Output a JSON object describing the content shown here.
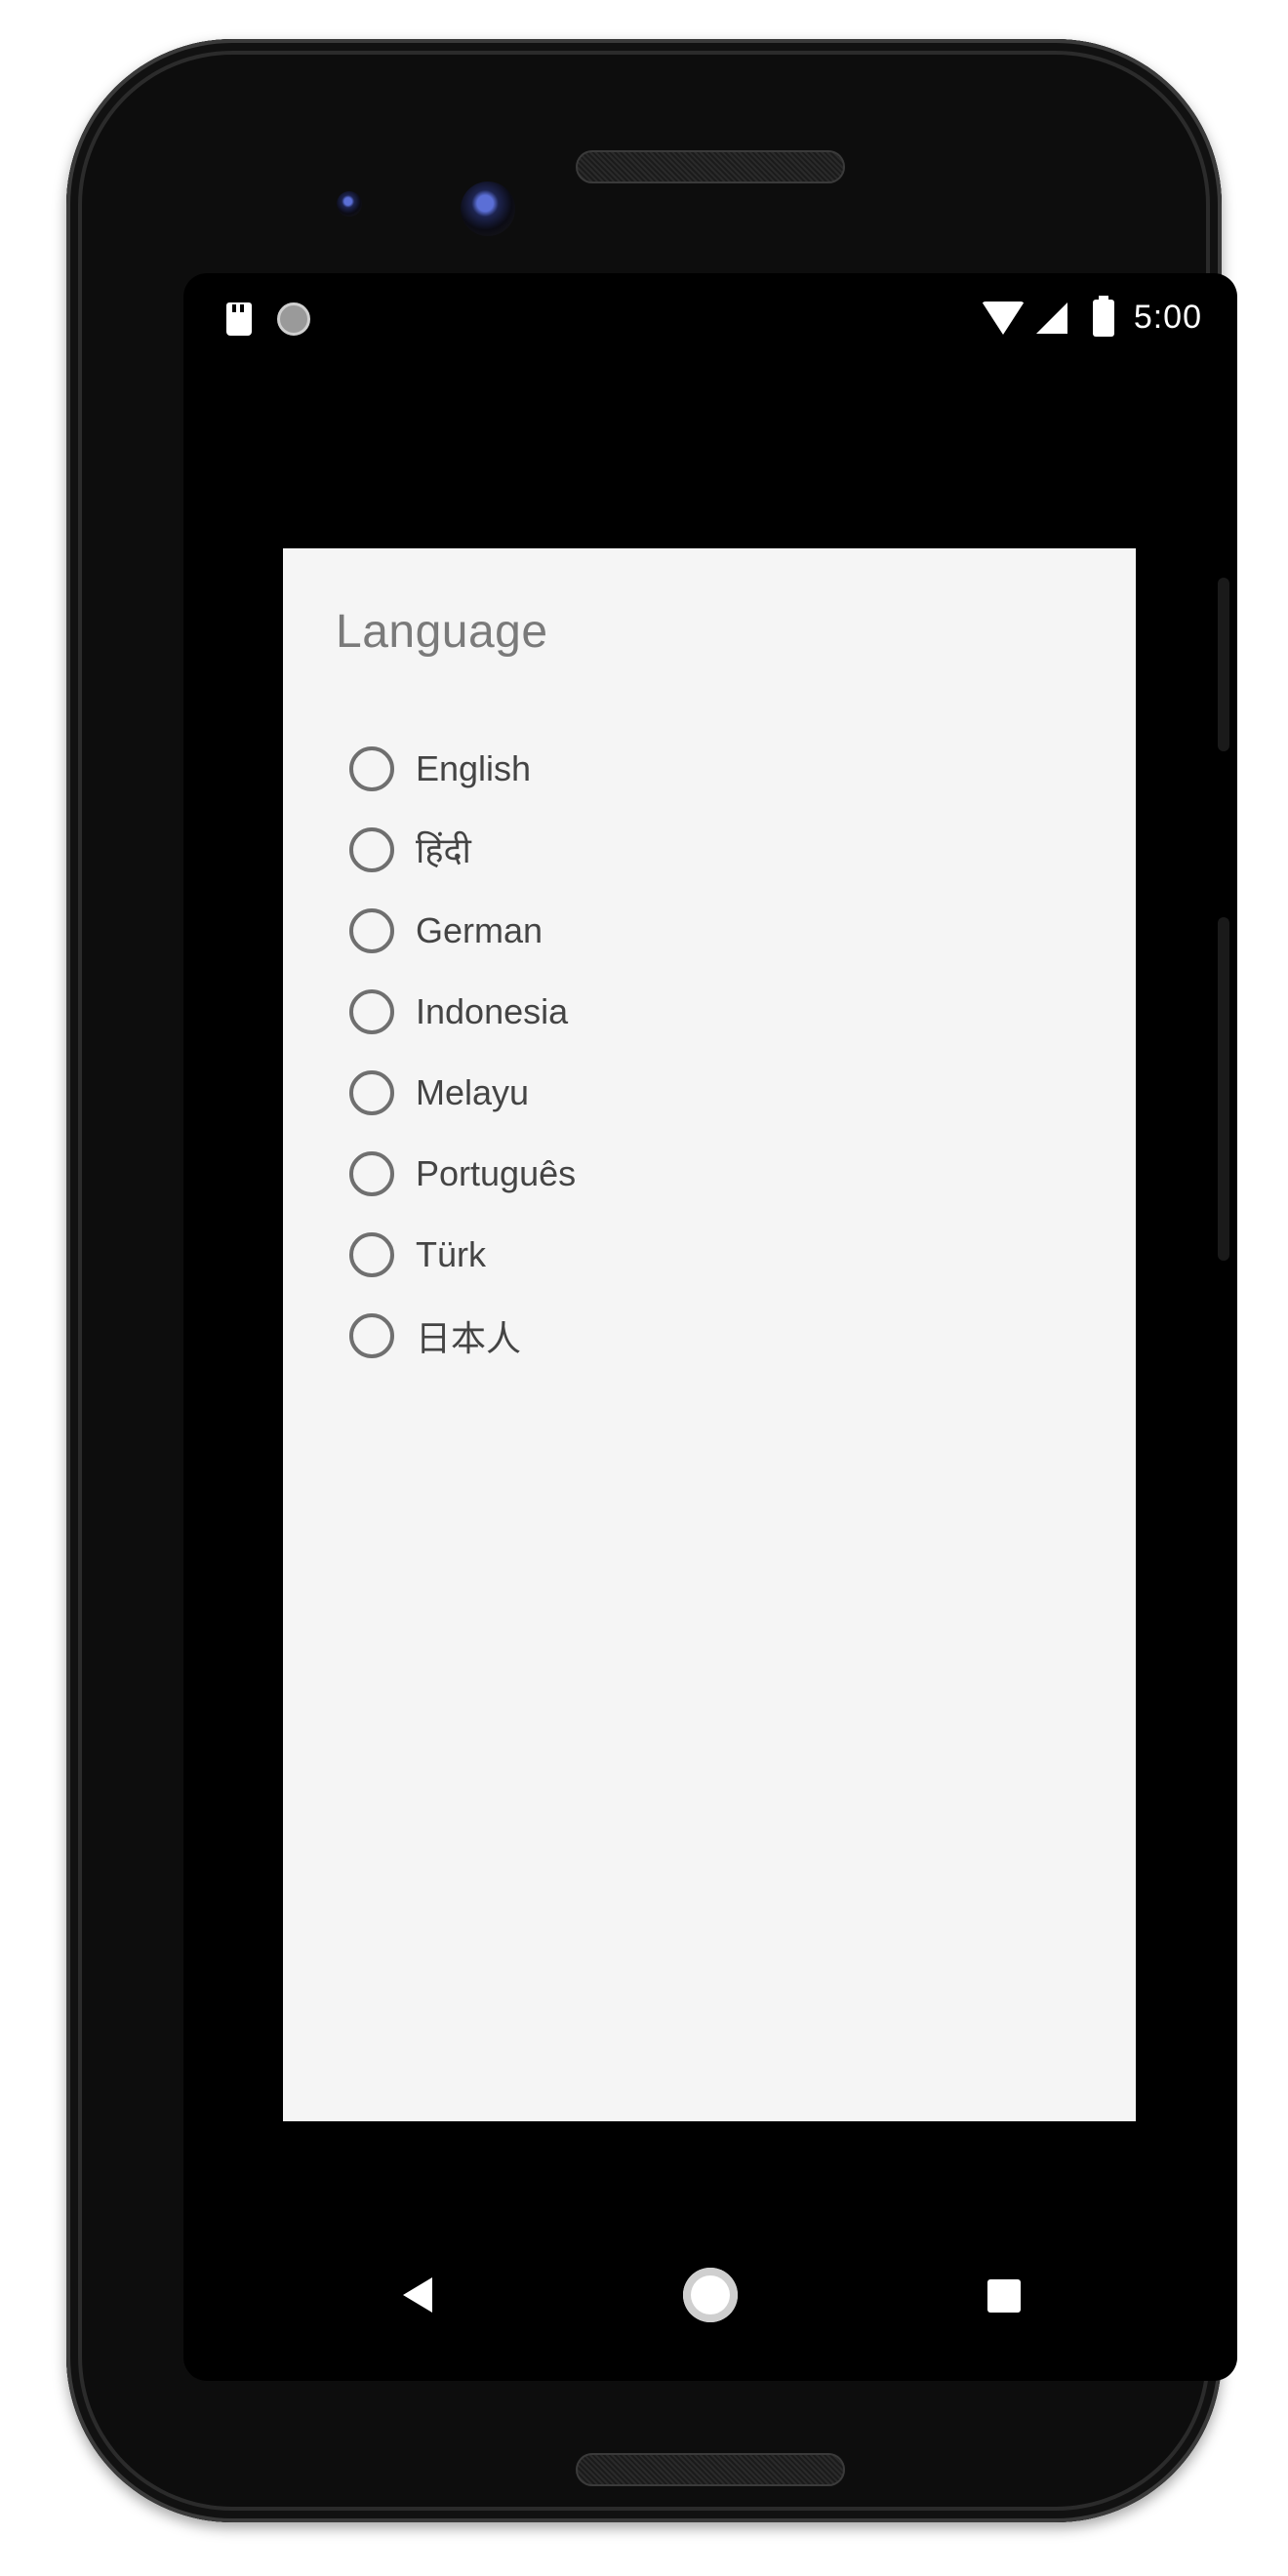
{
  "status_bar": {
    "time": "5:00",
    "left_icons": [
      "sd-card-icon",
      "screen-record-icon"
    ],
    "right_icons": [
      "wifi-icon",
      "signal-icon",
      "battery-icon"
    ]
  },
  "dialog": {
    "title": "Language",
    "options": [
      {
        "label": "English",
        "selected": false
      },
      {
        "label": "हिंदी",
        "selected": false
      },
      {
        "label": "German",
        "selected": false
      },
      {
        "label": "Indonesia",
        "selected": false
      },
      {
        "label": "Melayu",
        "selected": false
      },
      {
        "label": "Português",
        "selected": false
      },
      {
        "label": "Türk",
        "selected": false
      },
      {
        "label": "日本人",
        "selected": false
      }
    ]
  },
  "nav_bar": {
    "icons": [
      "back-icon",
      "home-icon",
      "recents-icon"
    ]
  }
}
